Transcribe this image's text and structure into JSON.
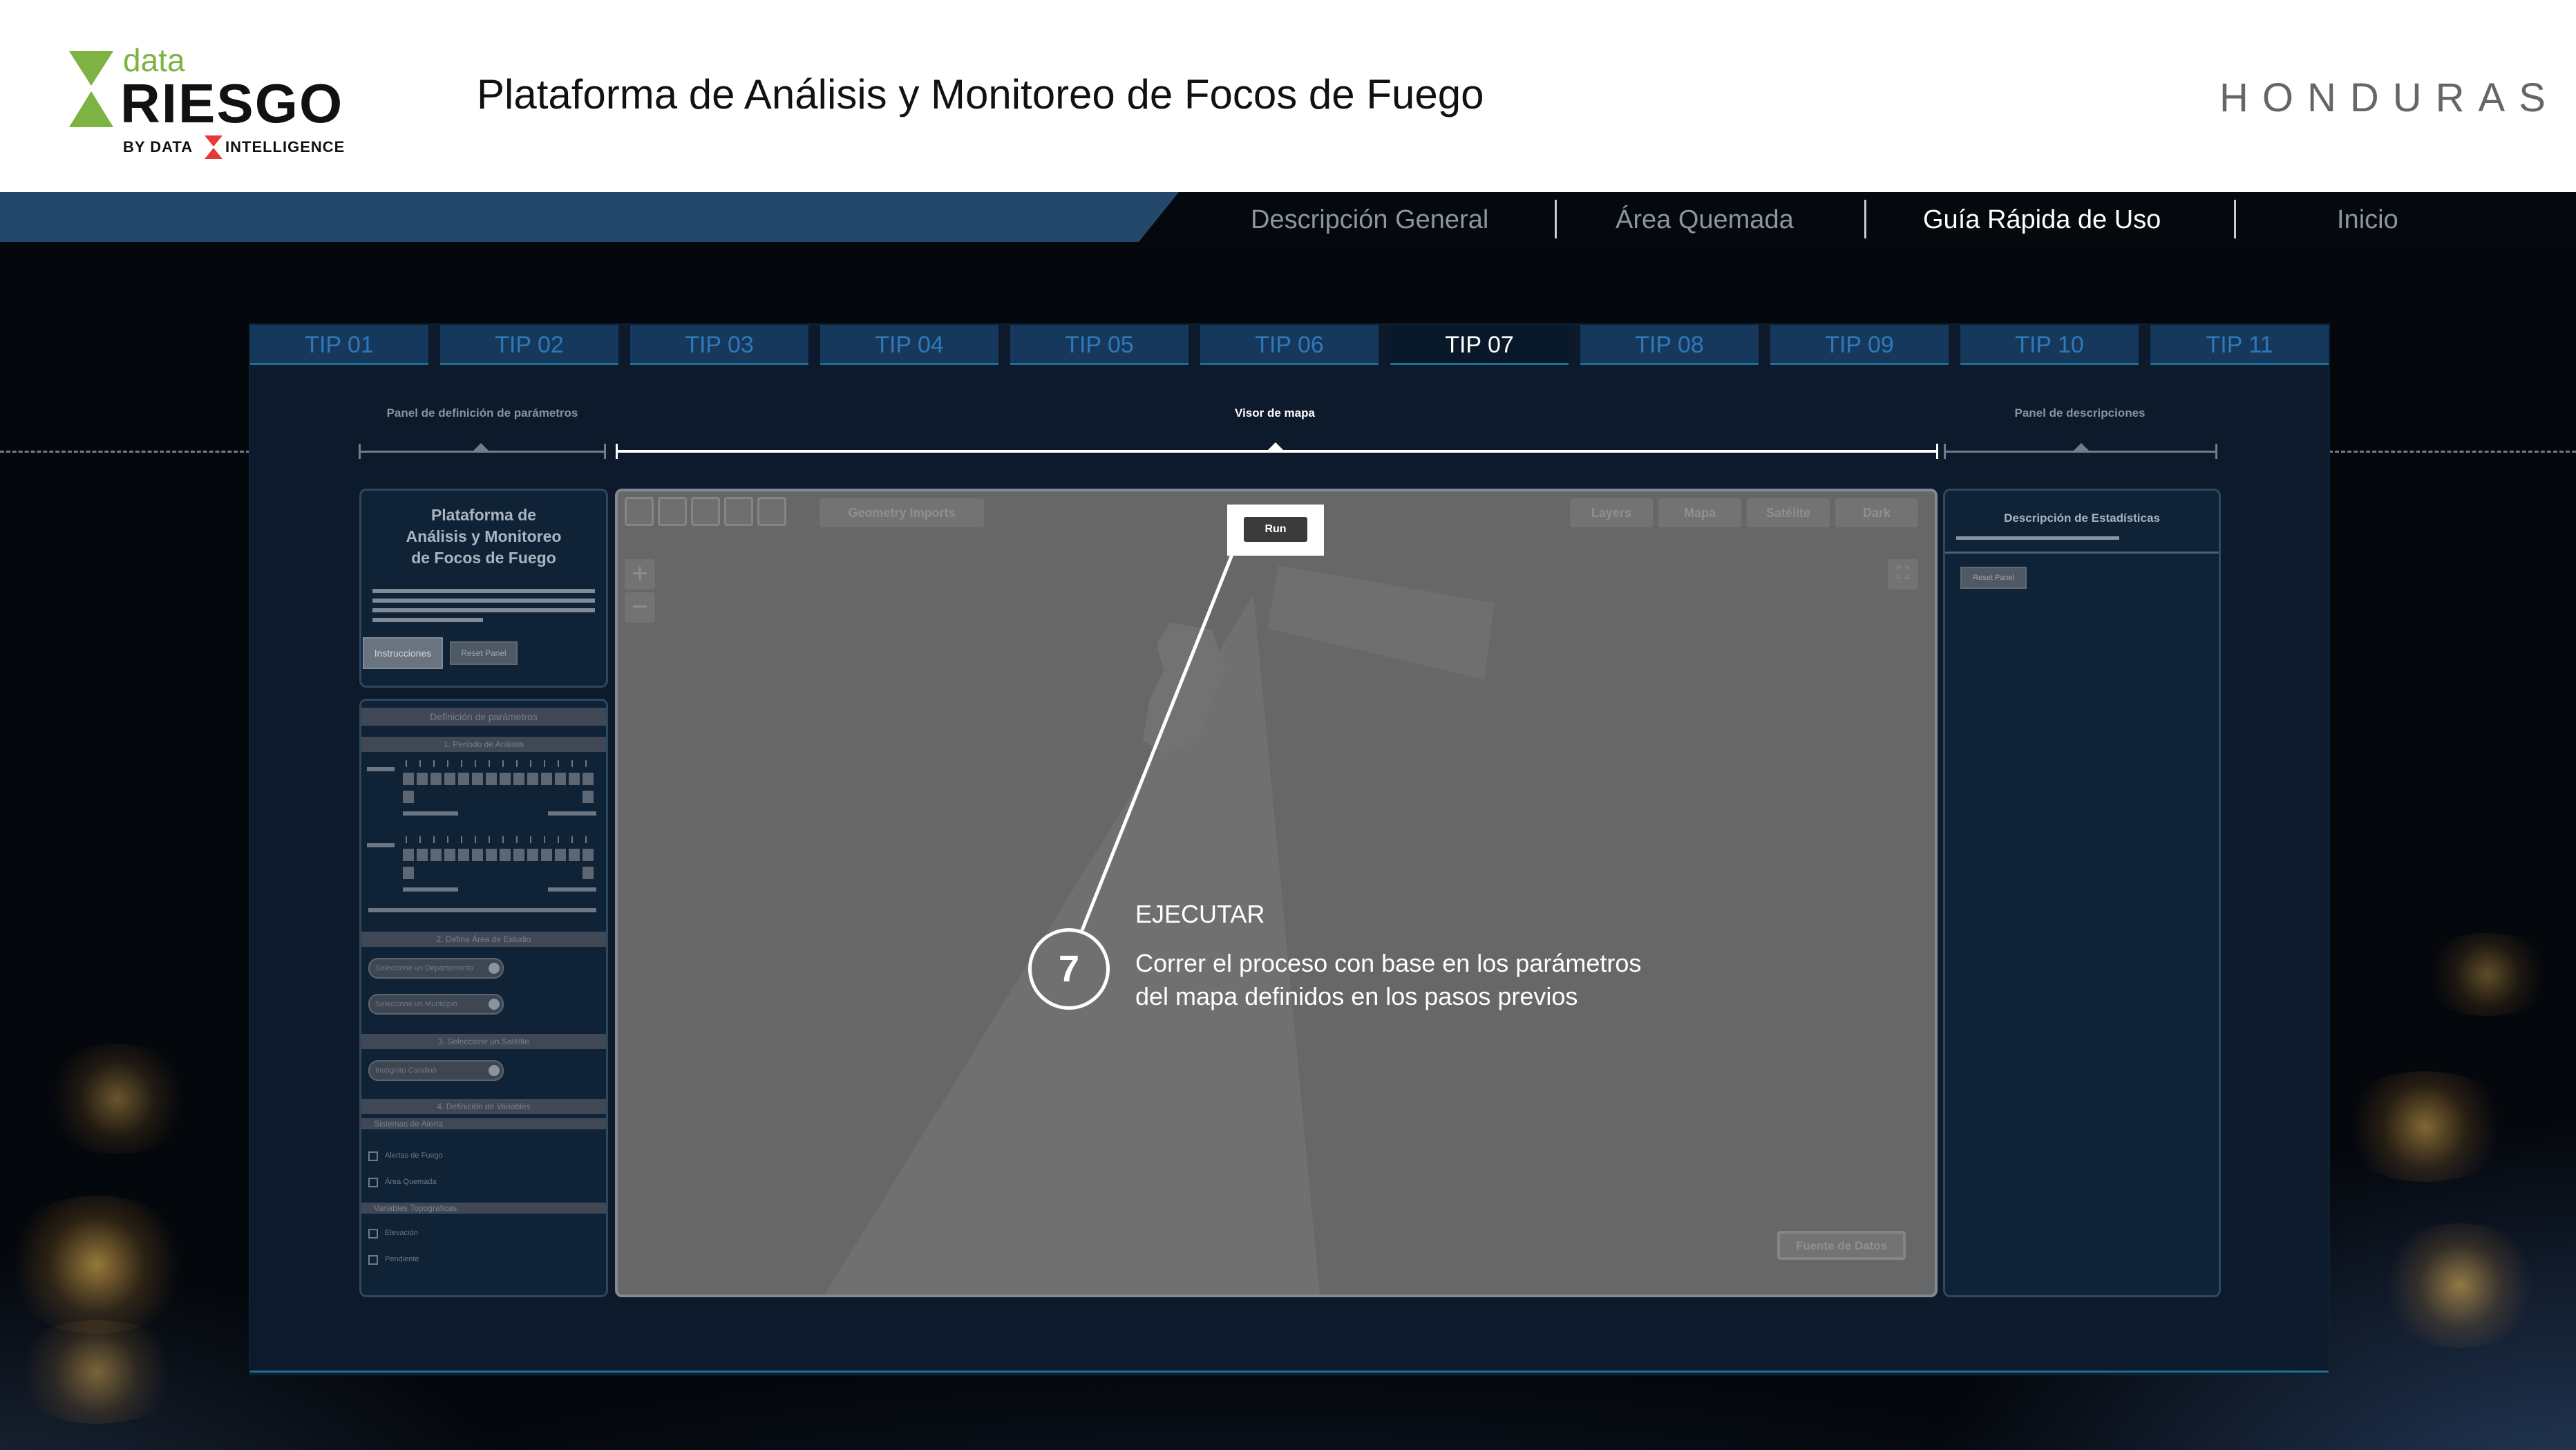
{
  "header": {
    "logo_data": "data",
    "logo_riesgo": "RIESGO",
    "logo_by": "BY DATA",
    "logo_intelligence": "INTELLIGENCE",
    "title": "Plataforma de Análisis y Monitoreo de Focos de Fuego",
    "country": "HONDURAS"
  },
  "nav": {
    "items": [
      {
        "label": "Descripción General",
        "active": false
      },
      {
        "label": "Área Quemada",
        "active": false
      },
      {
        "label": "Guía Rápida de Uso",
        "active": true
      },
      {
        "label": "Inicio",
        "active": false
      }
    ]
  },
  "tips": {
    "items": [
      "TIP 01",
      "TIP 02",
      "TIP 03",
      "TIP 04",
      "TIP 05",
      "TIP 06",
      "TIP 07",
      "TIP 08",
      "TIP 09",
      "TIP 10",
      "TIP 11"
    ],
    "active_index": 6
  },
  "sections": {
    "left": "Panel de definición de  parámetros",
    "center": "Visor de mapa",
    "right": "Panel de descripciones"
  },
  "left_panel": {
    "title_line1": "Plataforma de",
    "title_line2": "Análisis y Monitoreo",
    "title_line3": "de Focos de Fuego",
    "btn_instructions": "Instrucciones",
    "btn_reset": "Reset Panel",
    "params_header": "Definición de parámetros",
    "step1": "1. Período de Análisis",
    "step2": "2. Defina Área de Estudio",
    "select_department": "Seleccione un Departamento",
    "select_municipality": "Seleccione un Municipio",
    "step3": "3. Seleccione un Satélite",
    "select_satellite": "Incógnito Candinó",
    "step4": "4. Definición de Variables",
    "alert_systems": "Sistemas de Alerta",
    "cb_fire_alerts": "Alertas de Fuego",
    "cb_burned_area": "Área Quemada",
    "topo_vars": "Variables Topográficas",
    "cb_elevation": "Elevación",
    "cb_slope": "Pendiente"
  },
  "map": {
    "geometry_imports": "Geometry Imports",
    "run": "Run",
    "layers": "Layers",
    "mapa": "Mapa",
    "satelite": "Satélite",
    "dark": "Dark",
    "zoom_in": "+",
    "zoom_out": "−",
    "data_source": "Fuente de Datos"
  },
  "right_panel": {
    "title": "Descripción de Estadísticas",
    "reset": "Reset Panel"
  },
  "step": {
    "number": "7",
    "title": "EJECUTAR",
    "line1": "Correr el proceso con base en los parámetros",
    "line2": "del mapa definidos en los pasos previos"
  },
  "colors": {
    "brand_green": "#7cb342",
    "brand_red": "#e53935",
    "nav_blue": "#24486b",
    "tip_blue": "#16385c",
    "panel_bg": "#0c1a2b"
  },
  "icons": [
    "hand-icon",
    "point-icon",
    "line-icon",
    "shape-icon",
    "rectangle-icon",
    "fullscreen-icon",
    "satellite-icon"
  ]
}
